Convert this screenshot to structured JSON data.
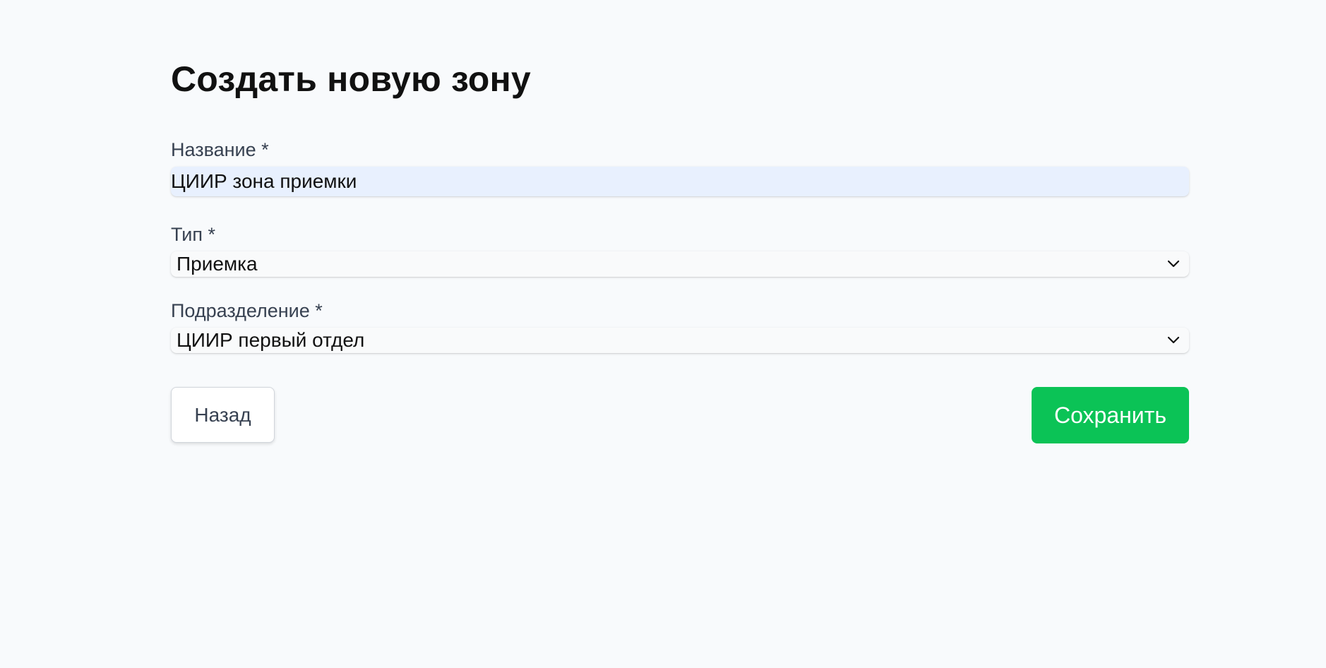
{
  "page": {
    "title": "Создать новую зону"
  },
  "form": {
    "name": {
      "label": "Название *",
      "value": "ЦИИР зона приемки"
    },
    "type": {
      "label": "Тип *",
      "selected": "Приемка",
      "icon": "chevron-down-icon"
    },
    "department": {
      "label": "Подразделение *",
      "selected": "ЦИИР первый отдел",
      "icon": "chevron-down-icon"
    }
  },
  "actions": {
    "back_label": "Назад",
    "save_label": "Сохранить"
  },
  "colors": {
    "background": "#f8fafc",
    "accent_green": "#0bc356",
    "autofill_input": "#e8f0fe"
  }
}
